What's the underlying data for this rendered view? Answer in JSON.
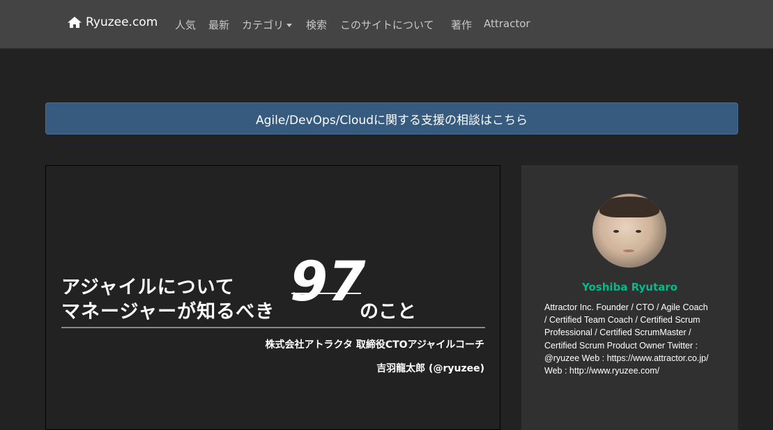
{
  "nav": {
    "brand": "Ryuzee.com",
    "items": [
      "人気",
      "最新",
      "カテゴリ",
      "検索",
      "このサイトについて",
      "著作",
      "Attractor"
    ]
  },
  "banner": {
    "text": "Agile/DevOps/Cloudに関する支援の相談はこちら"
  },
  "slide": {
    "line1": "アジャイルについて",
    "line2": "マネージャーが知るべき",
    "number": "97",
    "suffix": "のこと",
    "sub1": "株式会社アトラクタ 取締役CTOアジャイルコーチ",
    "sub2": "吉羽龍太郎 (@ryuzee)"
  },
  "profile": {
    "name": "Yoshiba Ryutaro",
    "bio": "Attractor Inc. Founder / CTO / Agile Coach / Certified Team Coach / Certified Scrum Professional / Certified ScrumMaster / Certified Scrum Product Owner Twitter : @ryuzee Web : https://www.attractor.co.jp/ Web : http://www.ryuzee.com/"
  },
  "colors": {
    "navbar": "#444444",
    "background": "#222222",
    "banner": "#375a7f",
    "accent": "#00bc8c"
  }
}
